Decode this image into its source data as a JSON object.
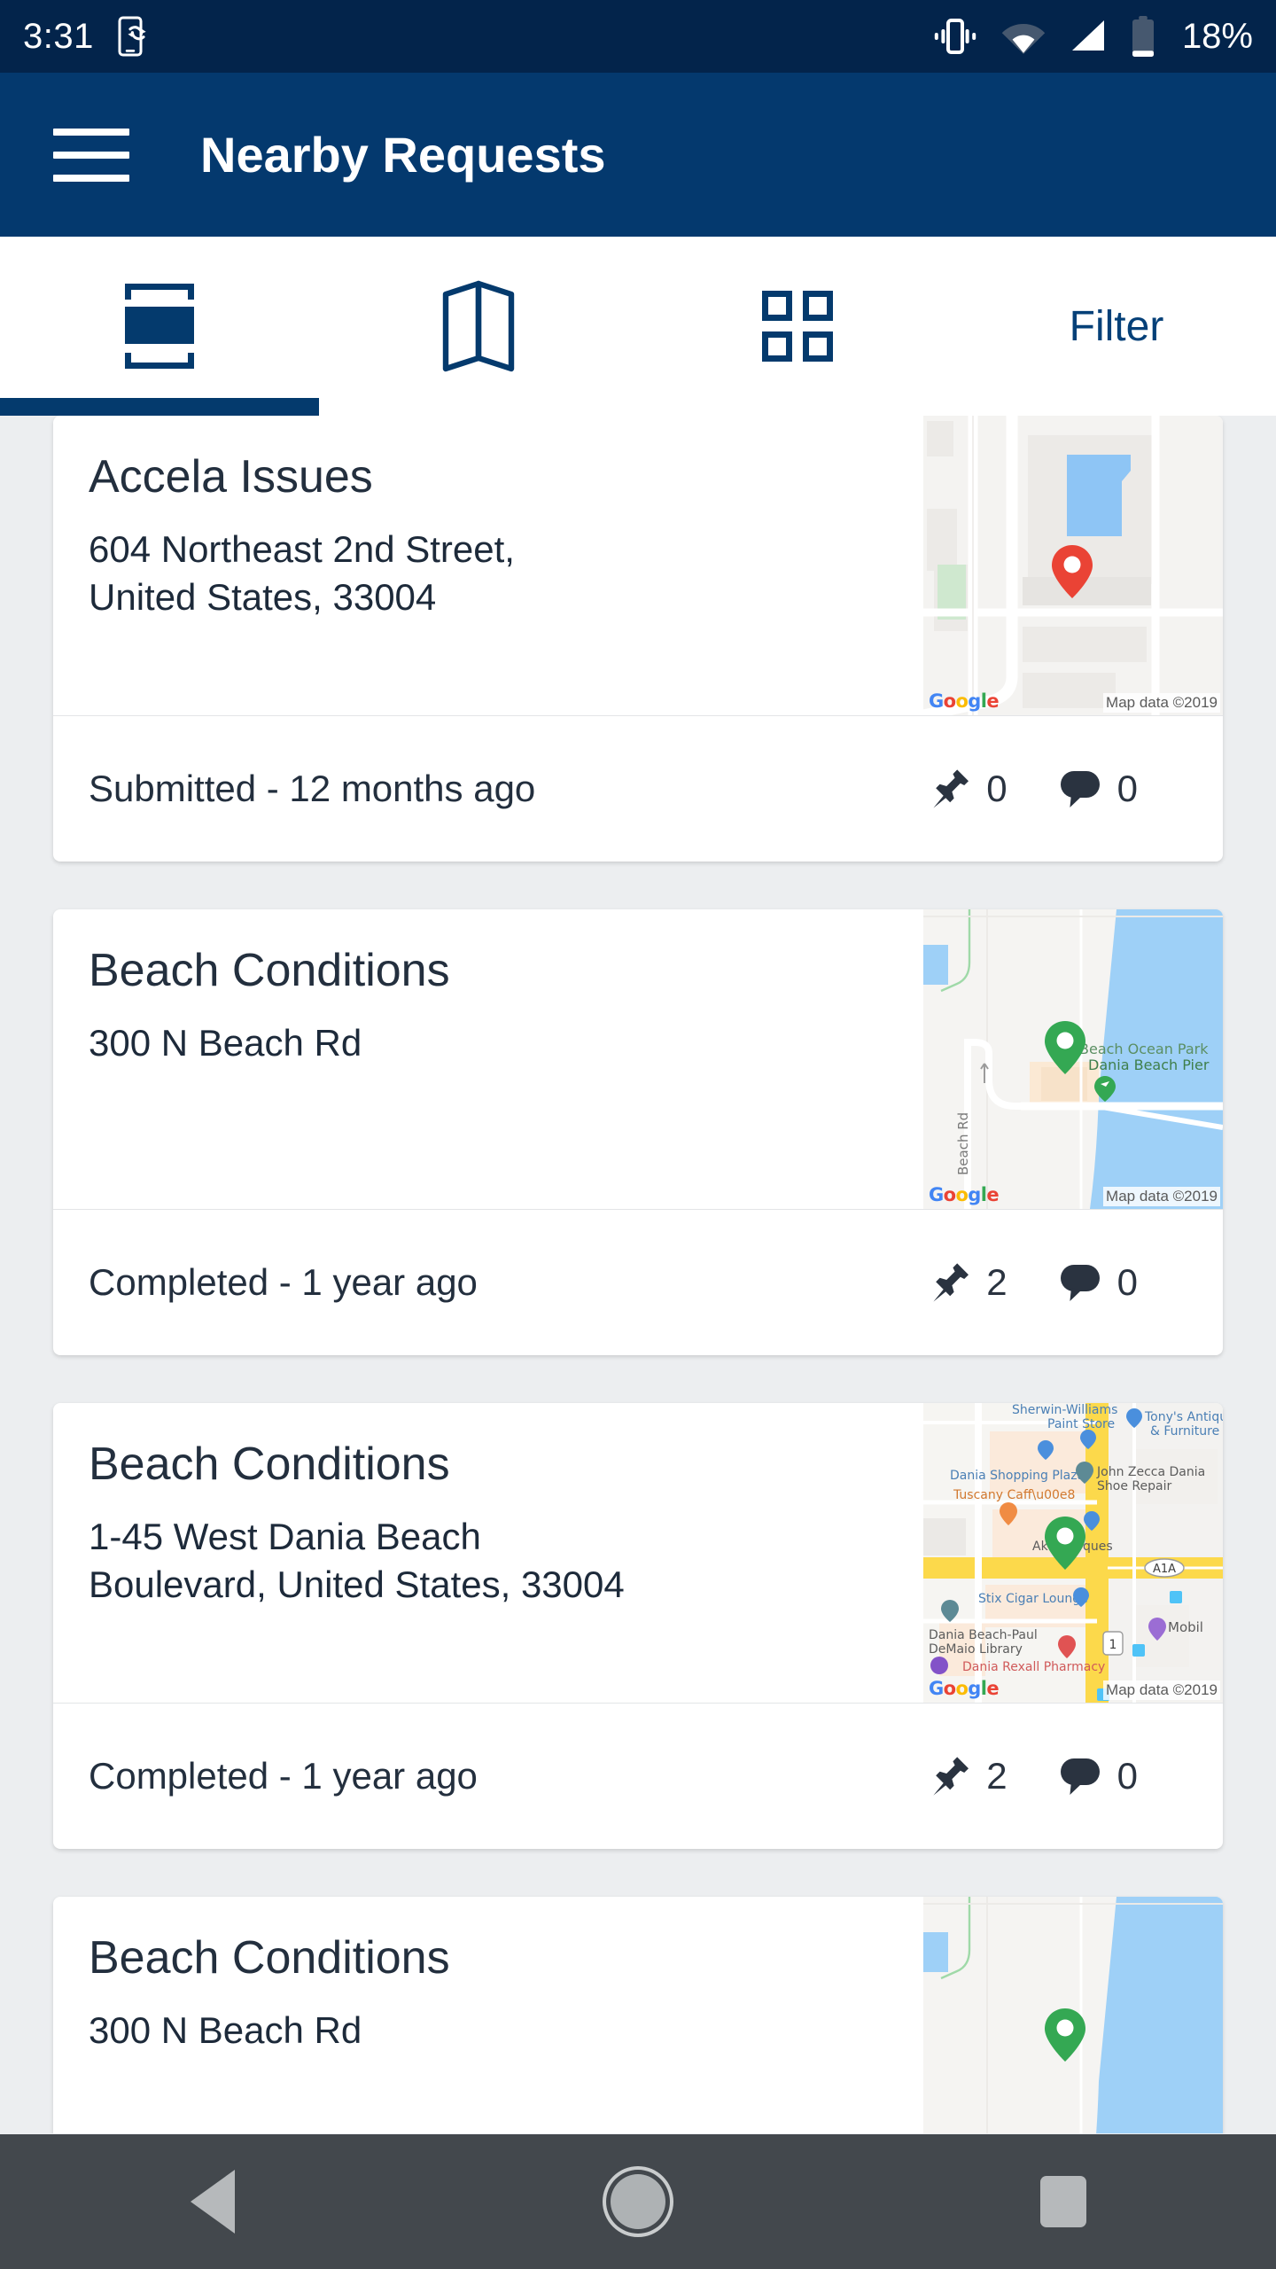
{
  "status_bar": {
    "time": "3:31",
    "battery_percent": "18%",
    "icons": [
      "phone-sync-icon",
      "vibrate-icon",
      "wifi-icon",
      "cellular-signal-icon",
      "battery-icon"
    ]
  },
  "app_bar": {
    "menu_icon": "hamburger-menu-icon",
    "title": "Nearby Requests"
  },
  "tabs": [
    {
      "id": "list",
      "icon": "view-carousel-icon",
      "label": "",
      "active": true
    },
    {
      "id": "map",
      "icon": "map-folded-icon",
      "label": "",
      "active": false
    },
    {
      "id": "grid",
      "icon": "grid-view-icon",
      "label": "",
      "active": false
    },
    {
      "id": "filter",
      "icon": "",
      "label": "Filter",
      "active": false
    }
  ],
  "colors": {
    "status_bar_bg": "#03244b",
    "app_bar_bg": "#04396e",
    "accent": "#043a6d",
    "page_bg": "#eceef0",
    "card_bg": "#ffffff",
    "text_primary": "#232f3e",
    "pin_red": "#ea4335",
    "pin_green": "#34a853"
  },
  "map_attribution": {
    "logo": [
      "G",
      "o",
      "o",
      "g",
      "l",
      "e"
    ],
    "copyright": "Map data ©2019"
  },
  "cards": [
    {
      "title": "Accela Issues",
      "address": "604   Northeast 2nd Street,\nUnited States, 33004",
      "status": "Submitted - 12 months ago",
      "pin_count": "0",
      "comment_count": "0",
      "map": {
        "pin_color": "#ea4335",
        "labels": []
      }
    },
    {
      "title": "Beach Conditions",
      "address": "300   N Beach Rd",
      "status": "Completed - 1 year ago",
      "pin_count": "2",
      "comment_count": "0",
      "map": {
        "pin_color": "#34a853",
        "labels": [
          "Beach Ocean Park",
          "Dania Beach Pier",
          "Beach Rd"
        ]
      }
    },
    {
      "title": "Beach Conditions",
      "address": "1-45   West Dania Beach\nBoulevard, United States, 33004",
      "status": "Completed - 1 year ago",
      "pin_count": "2",
      "comment_count": "0",
      "map": {
        "pin_color": "#34a853",
        "labels": [
          "Sherwin-Williams\nPaint Store",
          "Tony's Antiqu\n& Furniture",
          "Dania Shopping Plaza",
          "John Zecca Dania\nShoe Repair",
          "Tuscany Caffè",
          "Ak           ques",
          "Stix Cigar Lounge",
          "Dania Beach-Paul\nDeMaio Library",
          "Dania Rexall Pharmacy",
          "Mobil",
          "A1A",
          "1"
        ]
      }
    },
    {
      "title": "Beach Conditions",
      "address": "300   N Beach Rd",
      "status": "",
      "pin_count": "",
      "comment_count": "",
      "map": {
        "pin_color": "#34a853",
        "labels": []
      }
    }
  ],
  "nav_bar": {
    "back": "back-triangle-icon",
    "home": "home-circle-icon",
    "recent": "recent-apps-square-icon"
  }
}
